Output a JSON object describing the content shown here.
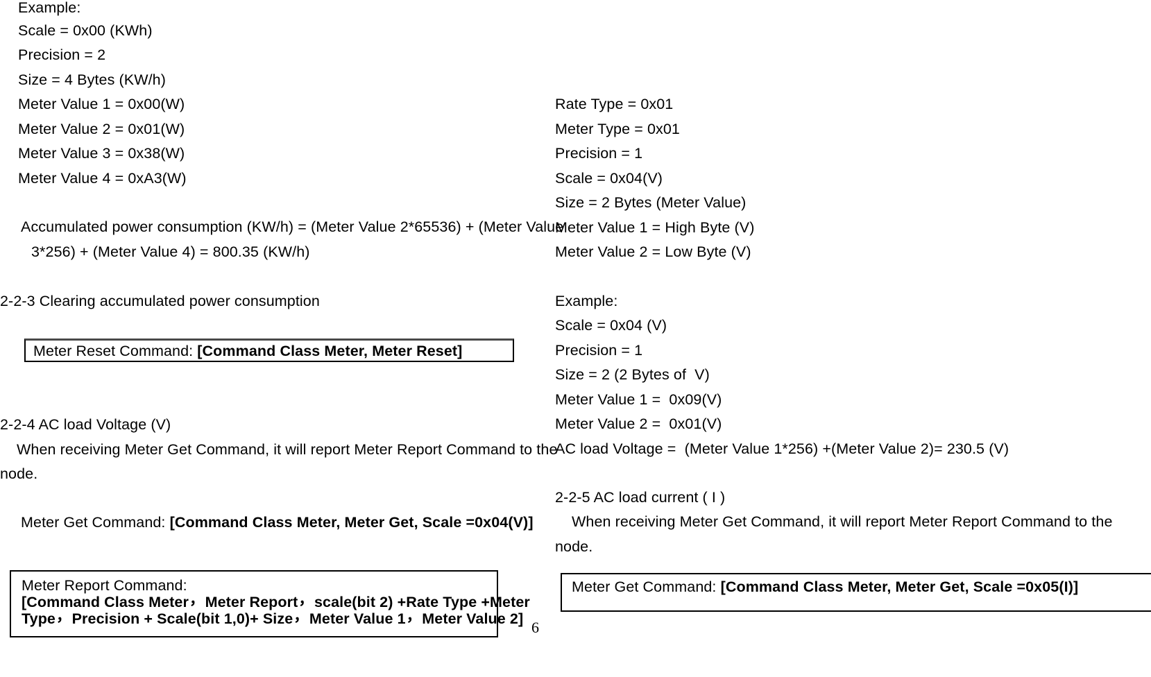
{
  "document": {
    "page_number": "6",
    "left_column": {
      "example_block": {
        "heading": "Example:",
        "lines": [
          "Scale = 0x00 (KWh)",
          "Precision = 2",
          "Size = 4 Bytes (KW/h)",
          "Meter Value 1 = 0x00(W)",
          "Meter Value 2 = 0x01(W)",
          "Meter Value 3 = 0x38(W)",
          "Meter Value 4 = 0xA3(W)"
        ]
      },
      "formula": {
        "line1": "Accumulated power consumption (KW/h) = (Meter Value 2*65536) + (Meter Value",
        "line2": "3*256) + (Meter Value 4) = 800.35 (KW/h)"
      },
      "section_223": {
        "heading": "2-2-3 Clearing accumulated power consumption"
      },
      "meter_reset_box": {
        "label": "Meter Reset Command: ",
        "command": "[Command Class Meter, Meter Reset]"
      },
      "section_224": {
        "heading": "2-2-4 AC load Voltage (V)",
        "body_line1": "When receiving Meter Get Command, it will report Meter Report Command to the",
        "body_line2": "node."
      },
      "meter_get_line": {
        "label": "Meter Get Command: ",
        "command": "[Command Class Meter, Meter Get, Scale =0x04(V)]"
      },
      "meter_report_box": {
        "label": "Meter Report Command:",
        "command_line1_a": "[Command Class Meter",
        "command_line1_b": "Meter Report",
        "command_line1_c": "scale(bit 2) +Rate Type +Meter",
        "command_line2_a": "Type",
        "command_line2_b": "Precision + Scale(bit 1,0)+ Size",
        "command_line2_c": "Meter Value 1",
        "command_line2_d": "Meter Value 2]",
        "comma": "，"
      }
    },
    "right_column": {
      "report_params": [
        "Rate Type = 0x01",
        "Meter Type = 0x01",
        "Precision = 1",
        "Scale = 0x04(V)",
        "Size = 2 Bytes (Meter Value)",
        "Meter Value 1 = High Byte (V)",
        "Meter Value 2 = Low Byte (V)"
      ],
      "example_block": {
        "heading": "Example:",
        "lines": [
          "Scale = 0x04 (V)",
          "Precision = 1",
          "Size = 2 (2 Bytes of  V)",
          "Meter Value 1 =  0x09(V)",
          "Meter Value 2 =  0x01(V)",
          "AC load Voltage =  (Meter Value 1*256) +(Meter Value 2)= 230.5 (V)"
        ]
      },
      "section_225": {
        "heading": "2-2-5 AC load current ( I )",
        "body_line1": "When receiving Meter Get Command, it will report Meter Report Command to the",
        "body_line2": "node."
      },
      "meter_get_box": {
        "label": "Meter Get Command: ",
        "command": "[Command Class Meter, Meter Get, Scale =0x05(I)]"
      }
    }
  }
}
